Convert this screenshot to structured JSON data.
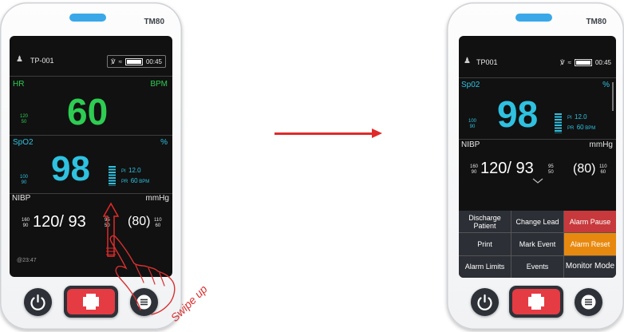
{
  "colors": {
    "accent_red": "#e02a2a",
    "hr_green": "#2ecc52",
    "spo2_cyan": "#2fc1e0",
    "alarm_pause": "#c7393c",
    "alarm_reset": "#e8890f"
  },
  "left_device": {
    "model": "TM80",
    "status": {
      "patient_id": "TP-001",
      "time": "00:45"
    },
    "hr": {
      "label": "HR",
      "unit": "BPM",
      "value": "60",
      "upper": "120",
      "lower": "50"
    },
    "spo2": {
      "label": "SpO2",
      "unit": "%",
      "value": "98",
      "upper": "100",
      "lower": "90",
      "pi_label": "PI",
      "pi_value": "12.0",
      "pr_label": "PR",
      "pr_value": "60",
      "pr_unit": "BPM"
    },
    "nibp": {
      "label": "NIBP",
      "unit": "mmHg",
      "value": "120/ 93",
      "mean": "(80)",
      "sys_upper": "160",
      "sys_lower": "90",
      "dia_upper": "95",
      "dia_lower": "50",
      "map_upper": "110",
      "map_lower": "60",
      "timestamp": "@23:47"
    }
  },
  "gesture": {
    "text": "Swipe up"
  },
  "right_device": {
    "model": "TM80",
    "status": {
      "patient_id": "TP001",
      "time": "00:45"
    },
    "spo2": {
      "label": "Sp02",
      "unit": "%",
      "value": "98",
      "upper": "100",
      "lower": "90",
      "pi_label": "PI",
      "pi_value": "12.0",
      "pr_label": "PR",
      "pr_value": "60",
      "pr_unit": "BPM"
    },
    "nibp": {
      "label": "NIBP",
      "unit": "mmHg",
      "value": "120/ 93",
      "mean": "(80)",
      "sys_upper": "160",
      "sys_lower": "90",
      "dia_upper": "95",
      "dia_lower": "50",
      "map_upper": "110",
      "map_lower": "60"
    },
    "menu": {
      "discharge_patient": "Discharge Patient",
      "change_lead": "Change Lead",
      "alarm_pause": "Alarm Pause",
      "print": "Print",
      "mark_event": "Mark Event",
      "alarm_reset": "Alarm Reset",
      "alarm_limits": "Alarm Limits",
      "events": "Events",
      "monitor_mode": "Monitor Mode"
    }
  },
  "icons": {
    "power": "power-icon",
    "emergency": "red-cross-icon",
    "menu": "hamburger-menu-icon",
    "signal": "signal-icon",
    "wifi": "wifi-icon",
    "battery": "battery-icon",
    "patient": "patient-icon"
  }
}
